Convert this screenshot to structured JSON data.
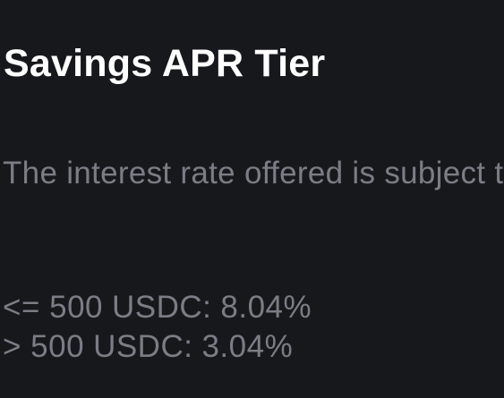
{
  "panel": {
    "title": "Savings APR Tier",
    "description": "The interest rate offered is subject to change",
    "tiers": [
      {
        "condition": "<= 500",
        "asset": "USDC:",
        "rate": "8.04%"
      },
      {
        "condition": "> 500",
        "asset": "USDC:",
        "rate": "3.04%"
      }
    ]
  },
  "colors": {
    "background": "#17181c",
    "title": "#ffffff",
    "muted_text": "#7a7d85"
  }
}
